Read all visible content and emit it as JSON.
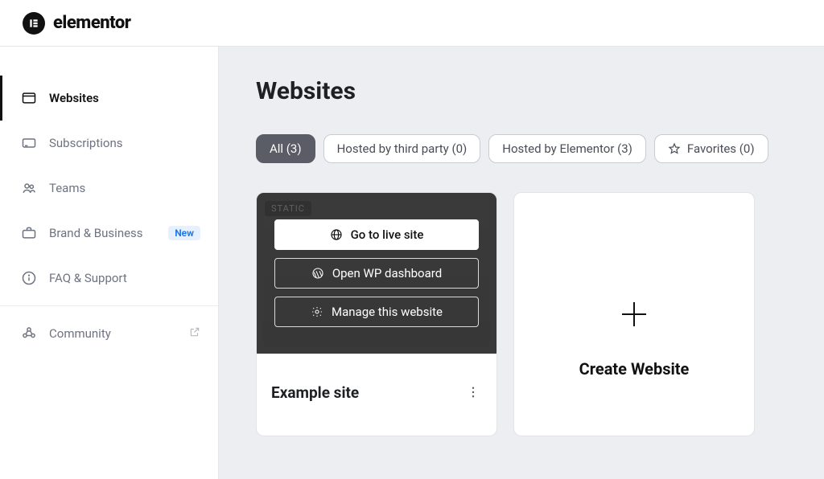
{
  "header": {
    "wordmark": "elementor"
  },
  "sidebar": {
    "items": [
      {
        "label": "Websites",
        "active": true
      },
      {
        "label": "Subscriptions"
      },
      {
        "label": "Teams"
      },
      {
        "label": "Brand & Business",
        "badge": "New"
      },
      {
        "label": "FAQ & Support"
      },
      {
        "label": "Community"
      }
    ]
  },
  "main": {
    "title": "Websites",
    "filters": {
      "all_label": "All (3)",
      "third_party_label": "Hosted by third party (0)",
      "elementor_label": "Hosted by Elementor (3)",
      "favorites_label": "Favorites (0)"
    },
    "site": {
      "tag": "STATIC",
      "buttons": {
        "live": "Go to live site",
        "wp": "Open WP dashboard",
        "manage": "Manage this website"
      },
      "name": "Example site"
    },
    "create_label": "Create Website"
  }
}
